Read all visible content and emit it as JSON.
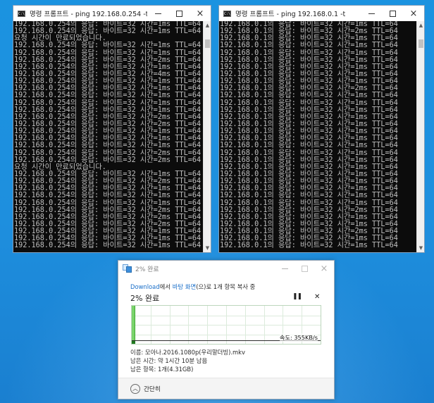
{
  "window1": {
    "icon_text": "C:\\",
    "title": "명령 프롬프트 - ping  192.168.0.254 -t",
    "lines": [
      "192.168.0.254의 응답: 바이트=32 시간=1ms TTL=64",
      "192.168.0.254의 응답: 바이트=32 시간=1ms TTL=64",
      "요청 시간이 만료되었습니다.",
      "192.168.0.254의 응답: 바이트=32 시간=1ms TTL=64",
      "192.168.0.254의 응답: 바이트=32 시간=1ms TTL=64",
      "192.168.0.254의 응답: 바이트=32 시간=2ms TTL=64",
      "192.168.0.254의 응답: 바이트=32 시간=1ms TTL=64",
      "192.168.0.254의 응답: 바이트=32 시간=4ms TTL=64",
      "192.168.0.254의 응답: 바이트=32 시간=1ms TTL=64",
      "192.168.0.254의 응답: 바이트=32 시간=1ms TTL=64",
      "192.168.0.254의 응답: 바이트=32 시간=1ms TTL=64",
      "192.168.0.254의 응답: 바이트=32 시간=1ms TTL=64",
      "192.168.0.254의 응답: 바이트=32 시간=1ms TTL=64",
      "192.168.0.254의 응답: 바이트=32 시간=2ms TTL=64",
      "192.168.0.254의 응답: 바이트=32 시간=2ms TTL=64",
      "192.168.0.254의 응답: 바이트=32 시간=1ms TTL=64",
      "192.168.0.254의 응답: 바이트=32 시간=1ms TTL=64",
      "192.168.0.254의 응답: 바이트=32 시간=1ms TTL=64",
      "192.168.0.254의 응답: 바이트=32 시간=2ms TTL=64",
      "192.168.0.254의 응답: 바이트=32 시간=2ms TTL=64",
      "요청 시간이 만료되었습니다.",
      "192.168.0.254의 응답: 바이트=32 시간=1ms TTL=64",
      "192.168.0.254의 응답: 바이트=32 시간=2ms TTL=64",
      "192.168.0.254의 응답: 바이트=32 시간=1ms TTL=64",
      "192.168.0.254의 응답: 바이트=32 시간=1ms TTL=64",
      "192.168.0.254의 응답: 바이트=32 시간=1ms TTL=64",
      "192.168.0.254의 응답: 바이트=32 시간=2ms TTL=64",
      "192.168.0.254의 응답: 바이트=32 시간=2ms TTL=64",
      "192.168.0.254의 응답: 바이트=32 시간=2ms TTL=64",
      "192.168.0.254의 응답: 바이트=32 시간=1ms TTL=64",
      "192.168.0.254의 응답: 바이트=32 시간=1ms TTL=64",
      "192.168.0.254의 응답: 바이트=32 시간=1ms TTL=64"
    ]
  },
  "window2": {
    "icon_text": "C:\\",
    "title": "명령 프롬프트 - ping  192.168.0.1 -t",
    "lines": [
      "192.168.0.1의 응답: 바이트=32 시간=1ms TTL=64",
      "192.168.0.1의 응답: 바이트=32 시간=2ms TTL=64",
      "192.168.0.1의 응답: 바이트=32 시간=1ms TTL=64",
      "192.168.0.1의 응답: 바이트=32 시간=1ms TTL=64",
      "192.168.0.1의 응답: 바이트=32 시간=1ms TTL=64",
      "192.168.0.1의 응답: 바이트=32 시간=1ms TTL=64",
      "192.168.0.1의 응답: 바이트=32 시간=1ms TTL=64",
      "192.168.0.1의 응답: 바이트=32 시간=1ms TTL=64",
      "192.168.0.1의 응답: 바이트=32 시간=1ms TTL=64",
      "192.168.0.1의 응답: 바이트=32 시간=2ms TTL=64",
      "192.168.0.1의 응답: 바이트=32 시간=1ms TTL=64",
      "192.168.0.1의 응답: 바이트=32 시간=1ms TTL=64",
      "192.168.0.1의 응답: 바이트=32 시간=1ms TTL=64",
      "192.168.0.1의 응답: 바이트=32 시간=1ms TTL=64",
      "192.168.0.1의 응답: 바이트=32 시간=1ms TTL=64",
      "192.168.0.1의 응답: 바이트=32 시간=1ms TTL=64",
      "192.168.0.1의 응답: 바이트=32 시간=1ms TTL=64",
      "192.168.0.1의 응답: 바이트=32 시간=1ms TTL=64",
      "192.168.0.1의 응답: 바이트=32 시간=1ms TTL=64",
      "192.168.0.1의 응답: 바이트=32 시간=1ms TTL=64",
      "192.168.0.1의 응답: 바이트=32 시간=1ms TTL=64",
      "192.168.0.1의 응답: 바이트=32 시간=1ms TTL=64",
      "192.168.0.1의 응답: 바이트=32 시간=1ms TTL=64",
      "192.168.0.1의 응답: 바이트=32 시간=1ms TTL=64",
      "192.168.0.1의 응답: 바이트=32 시간=1ms TTL=64",
      "192.168.0.1의 응답: 바이트=32 시간=1ms TTL=64",
      "192.168.0.1의 응답: 바이트=32 시간=2ms TTL=64",
      "192.168.0.1의 응답: 바이트=32 시간=1ms TTL=64",
      "192.168.0.1의 응답: 바이트=32 시간=1ms TTL=64",
      "192.168.0.1의 응답: 바이트=32 시간=2ms TTL=64",
      "192.168.0.1의 응답: 바이트=32 시간=1ms TTL=64",
      "192.168.0.1의 응답: 바이트=32 시간=1ms TTL=64"
    ]
  },
  "window_buttons": {
    "minimize": "minimize-icon",
    "maximize": "maximize-icon",
    "close": "×"
  },
  "scroll": {
    "up": "▲",
    "down": "▼"
  },
  "copy_dialog": {
    "title": "2% 완료",
    "source_link": "Download",
    "from_text": "에서 ",
    "dest_link": "바탕 화면",
    "rest_text": "(으)로 1개 항목 복사 중",
    "percent_heading": "2% 완료",
    "pause_label": "❚❚",
    "cancel_label": "✕",
    "progress_fraction": 0.02,
    "speed_level_fraction": 0.1,
    "speed_label": "속도: 355KB/s",
    "name_line": "이름: 모아나.2016.1080p(우리말더빙).mkv",
    "time_line": "남은 시간: 약 1시간 10분 남음",
    "items_line": "남은 항목: 1개(4.31GB)",
    "collapse_label": "간단히",
    "chevron": "︿"
  },
  "colors": {
    "desktop": "#1e8fde",
    "console_bg": "#0c0c0c",
    "console_fg": "#c0c0c0",
    "link": "#1a6fc9",
    "progress_fill": "#79d36b"
  }
}
